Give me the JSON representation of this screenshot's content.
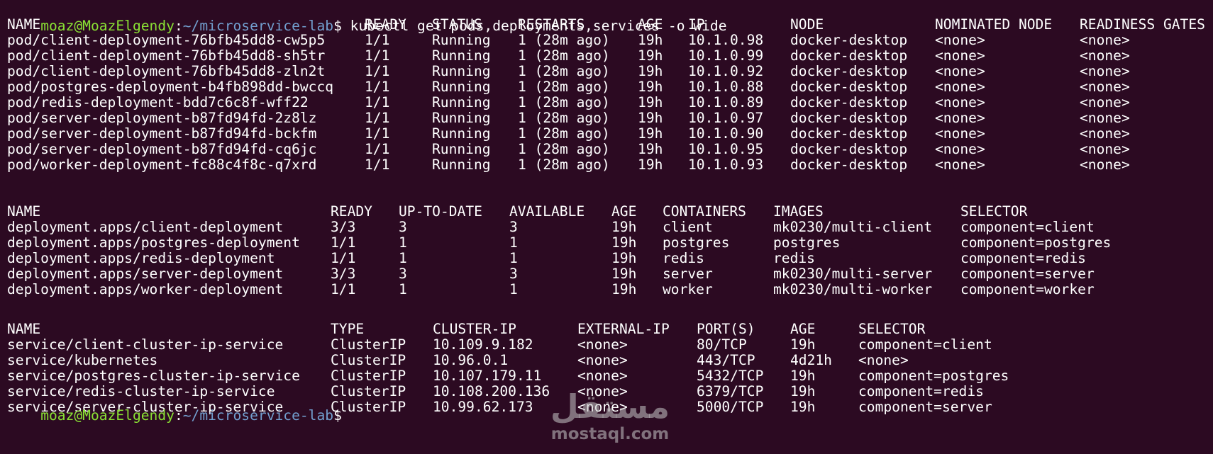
{
  "prompt": {
    "user_host": "moaz@MoazElgendy",
    "colon": ":",
    "path": "~/microservice-lab",
    "symbol": "$"
  },
  "command": "kubectl get pods,deployments,services -o wide",
  "pods": {
    "headers": [
      "NAME",
      "READY",
      "STATUS",
      "RESTARTS",
      "AGE",
      "IP",
      "NODE",
      "NOMINATED NODE",
      "READINESS GATES"
    ],
    "rows": [
      [
        "pod/client-deployment-76bfb45dd8-cw5p5",
        "1/1",
        "Running",
        "1 (28m ago)",
        "19h",
        "10.1.0.98",
        "docker-desktop",
        "<none>",
        "<none>"
      ],
      [
        "pod/client-deployment-76bfb45dd8-sh5tr",
        "1/1",
        "Running",
        "1 (28m ago)",
        "19h",
        "10.1.0.99",
        "docker-desktop",
        "<none>",
        "<none>"
      ],
      [
        "pod/client-deployment-76bfb45dd8-zln2t",
        "1/1",
        "Running",
        "1 (28m ago)",
        "19h",
        "10.1.0.92",
        "docker-desktop",
        "<none>",
        "<none>"
      ],
      [
        "pod/postgres-deployment-b4fb898dd-bwccq",
        "1/1",
        "Running",
        "1 (28m ago)",
        "19h",
        "10.1.0.88",
        "docker-desktop",
        "<none>",
        "<none>"
      ],
      [
        "pod/redis-deployment-bdd7c6c8f-wff22",
        "1/1",
        "Running",
        "1 (28m ago)",
        "19h",
        "10.1.0.89",
        "docker-desktop",
        "<none>",
        "<none>"
      ],
      [
        "pod/server-deployment-b87fd94fd-2z8lz",
        "1/1",
        "Running",
        "1 (28m ago)",
        "19h",
        "10.1.0.97",
        "docker-desktop",
        "<none>",
        "<none>"
      ],
      [
        "pod/server-deployment-b87fd94fd-bckfm",
        "1/1",
        "Running",
        "1 (28m ago)",
        "19h",
        "10.1.0.90",
        "docker-desktop",
        "<none>",
        "<none>"
      ],
      [
        "pod/server-deployment-b87fd94fd-cq6jc",
        "1/1",
        "Running",
        "1 (28m ago)",
        "19h",
        "10.1.0.95",
        "docker-desktop",
        "<none>",
        "<none>"
      ],
      [
        "pod/worker-deployment-fc88c4f8c-q7xrd",
        "1/1",
        "Running",
        "1 (28m ago)",
        "19h",
        "10.1.0.93",
        "docker-desktop",
        "<none>",
        "<none>"
      ]
    ]
  },
  "deployments": {
    "headers": [
      "NAME",
      "READY",
      "UP-TO-DATE",
      "AVAILABLE",
      "AGE",
      "CONTAINERS",
      "IMAGES",
      "SELECTOR"
    ],
    "rows": [
      [
        "deployment.apps/client-deployment",
        "3/3",
        "3",
        "3",
        "19h",
        "client",
        "mk0230/multi-client",
        "component=client"
      ],
      [
        "deployment.apps/postgres-deployment",
        "1/1",
        "1",
        "1",
        "19h",
        "postgres",
        "postgres",
        "component=postgres"
      ],
      [
        "deployment.apps/redis-deployment",
        "1/1",
        "1",
        "1",
        "19h",
        "redis",
        "redis",
        "component=redis"
      ],
      [
        "deployment.apps/server-deployment",
        "3/3",
        "3",
        "3",
        "19h",
        "server",
        "mk0230/multi-server",
        "component=server"
      ],
      [
        "deployment.apps/worker-deployment",
        "1/1",
        "1",
        "1",
        "19h",
        "worker",
        "mk0230/multi-worker",
        "component=worker"
      ]
    ]
  },
  "services": {
    "headers": [
      "NAME",
      "TYPE",
      "CLUSTER-IP",
      "EXTERNAL-IP",
      "PORT(S)",
      "AGE",
      "SELECTOR"
    ],
    "rows": [
      [
        "service/client-cluster-ip-service",
        "ClusterIP",
        "10.109.9.182",
        "<none>",
        "80/TCP",
        "19h",
        "component=client"
      ],
      [
        "service/kubernetes",
        "ClusterIP",
        "10.96.0.1",
        "<none>",
        "443/TCP",
        "4d21h",
        "<none>"
      ],
      [
        "service/postgres-cluster-ip-service",
        "ClusterIP",
        "10.107.179.11",
        "<none>",
        "5432/TCP",
        "19h",
        "component=postgres"
      ],
      [
        "service/redis-cluster-ip-service",
        "ClusterIP",
        "10.108.200.136",
        "<none>",
        "6379/TCP",
        "19h",
        "component=redis"
      ],
      [
        "service/server-cluster-ip-service",
        "ClusterIP",
        "10.99.62.173",
        "<none>",
        "5000/TCP",
        "19h",
        "component=server"
      ]
    ]
  },
  "watermark": {
    "arabic": "مستقل",
    "latin": "mostaql.com"
  },
  "colors": {
    "background": "#2c0a22",
    "prompt_user": "#8ae234",
    "prompt_path": "#729fcf",
    "text": "#ffffff"
  }
}
